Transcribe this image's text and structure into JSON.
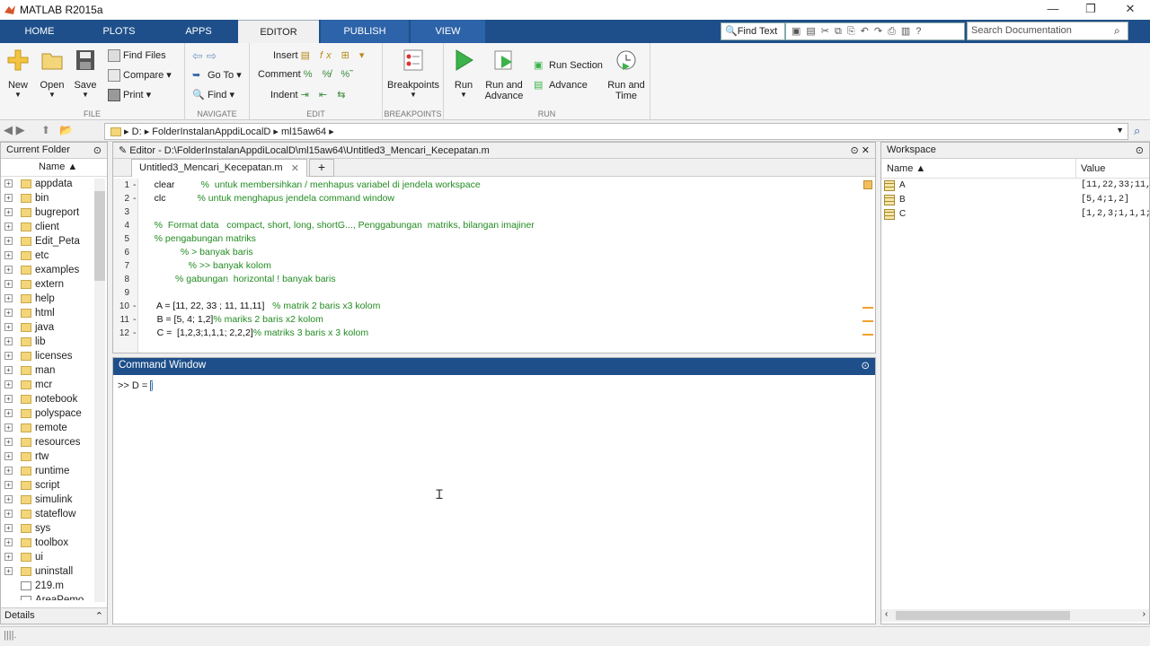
{
  "window": {
    "title": "MATLAB R2015a",
    "minimize_glyph": "—",
    "restore_glyph": "❐",
    "close_glyph": "✕"
  },
  "tabs": [
    {
      "label": "HOME"
    },
    {
      "label": "PLOTS"
    },
    {
      "label": "APPS"
    },
    {
      "label": "EDITOR",
      "active": true
    },
    {
      "label": "PUBLISH"
    },
    {
      "label": "VIEW"
    }
  ],
  "quick": {
    "find_text": "Find Text",
    "search_placeholder": "Search Documentation"
  },
  "ribbon": {
    "file": {
      "label": "FILE",
      "new": "New",
      "open": "Open",
      "save": "Save",
      "find_files": "Find Files",
      "compare": "Compare",
      "print": "Print"
    },
    "navigate": {
      "label": "NAVIGATE",
      "go_to": "Go To",
      "find": "Find"
    },
    "edit": {
      "label": "EDIT",
      "insert": "Insert",
      "comment": "Comment",
      "indent": "Indent"
    },
    "breakpoints": {
      "label": "BREAKPOINTS",
      "breakpoints": "Breakpoints"
    },
    "run": {
      "label": "RUN",
      "run": "Run",
      "run_and_advance_1": "Run and",
      "run_and_advance_2": "Advance",
      "run_section": "Run Section",
      "advance": "Advance",
      "run_and_time_1": "Run and",
      "run_and_time_2": "Time"
    }
  },
  "address": {
    "path": [
      "D:",
      "FolderInstalanAppdiLocalD",
      "ml15aw64"
    ]
  },
  "current_folder": {
    "title": "Current Folder",
    "column": "Name ▲",
    "items": [
      "appdata",
      "bin",
      "bugreport",
      "client",
      "Edit_Peta",
      "etc",
      "examples",
      "extern",
      "help",
      "html",
      "java",
      "lib",
      "licenses",
      "man",
      "mcr",
      "notebook",
      "polyspace",
      "remote",
      "resources",
      "rtw",
      "runtime",
      "script",
      "simulink",
      "stateflow",
      "sys",
      "toolbox",
      "ui",
      "uninstall"
    ],
    "files": [
      "219.m",
      "AreaPemo..."
    ],
    "details": "Details"
  },
  "editor": {
    "title": "Editor - D:\\FolderInstalanAppdiLocalD\\ml15aw64\\Untitled3_Mencari_Kecepatan.m",
    "tab": "Untitled3_Mencari_Kecepatan.m",
    "lines": [
      {
        "n": "1",
        "dash": "-",
        "code": "    clear",
        "comment": "          %  untuk membersihkan / menhapus variabel di jendela workspace"
      },
      {
        "n": "2",
        "dash": "-",
        "code": "    clc",
        "comment": "            % untuk menghapus jendela command window"
      },
      {
        "n": "3",
        "dash": "",
        "code": "",
        "comment": ""
      },
      {
        "n": "4",
        "dash": "",
        "code": "",
        "comment": "    %  Format data   compact, short, long, shortG..., Penggabungan  matriks, bilangan imajiner"
      },
      {
        "n": "5",
        "dash": "",
        "code": "",
        "comment": "    % pengabungan matriks"
      },
      {
        "n": "6",
        "dash": "",
        "code": "",
        "comment": "              % > banyak baris"
      },
      {
        "n": "7",
        "dash": "",
        "code": "",
        "comment": "                 % >> banyak kolom"
      },
      {
        "n": "8",
        "dash": "",
        "code": "",
        "comment": "            % gabungan  horizontal ! banyak baris"
      },
      {
        "n": "9",
        "dash": "",
        "code": "",
        "comment": ""
      },
      {
        "n": "10",
        "dash": "-",
        "code": "     A = [11, 22, 33 ; 11, 11,11]",
        "comment": "   % matrik 2 baris x3 kolom"
      },
      {
        "n": "11",
        "dash": "-",
        "code": "     B = [5, 4; 1,2]",
        "comment": "% mariks 2 baris x2 kolom"
      },
      {
        "n": "12",
        "dash": "-",
        "code": "     C =  [1,2,3;1,1,1; 2,2,2]",
        "comment": "% matriks 3 baris x 3 kolom"
      }
    ]
  },
  "command_window": {
    "title": "Command Window",
    "prompt": ">> D = ",
    "input": "["
  },
  "workspace": {
    "title": "Workspace",
    "col_name": "Name ▲",
    "col_value": "Value",
    "vars": [
      {
        "name": "A",
        "value": "[11,22,33;11,"
      },
      {
        "name": "B",
        "value": "[5,4;1,2]"
      },
      {
        "name": "C",
        "value": "[1,2,3;1,1,1;"
      }
    ]
  },
  "statusbar": {
    "busy": "||||."
  }
}
